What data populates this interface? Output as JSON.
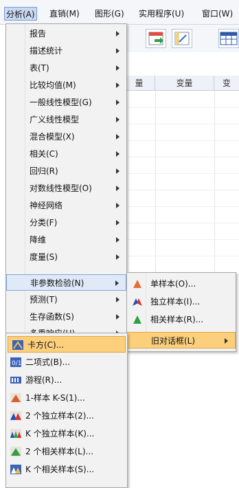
{
  "menubar": {
    "items": [
      {
        "label": "分析(A)",
        "active": true
      },
      {
        "label": "直销(M)"
      },
      {
        "label": "图形(G)"
      },
      {
        "label": "实用程序(U)"
      },
      {
        "label": "窗口(W)"
      }
    ]
  },
  "grid": {
    "col1": "量",
    "col2": "变量",
    "col3": "变"
  },
  "analyze_menu": {
    "items": [
      {
        "label": "报告"
      },
      {
        "label": "描述统计"
      },
      {
        "label": "表(T)"
      },
      {
        "label": "比较均值(M)"
      },
      {
        "label": "一般线性模型(G)"
      },
      {
        "label": "广义线性模型"
      },
      {
        "label": "混合模型(X)"
      },
      {
        "label": "相关(C)"
      },
      {
        "label": "回归(R)"
      },
      {
        "label": "对数线性模型(O)"
      },
      {
        "label": "神经网络"
      },
      {
        "label": "分类(F)"
      },
      {
        "label": "降维"
      },
      {
        "label": "度量(S)"
      },
      {
        "label": "非参数检验(N)"
      },
      {
        "label": "预测(T)"
      },
      {
        "label": "生存函数(S)"
      },
      {
        "label": "多重响应(U)"
      }
    ]
  },
  "nonparam_menu": {
    "items": [
      {
        "label": "单样本(O)...",
        "icon": "one-sample-icon"
      },
      {
        "label": "独立样本(I)...",
        "icon": "independent-samples-icon"
      },
      {
        "label": "相关样本(R)...",
        "icon": "related-samples-icon"
      },
      {
        "label": "旧对话框(L)",
        "icon": ""
      }
    ]
  },
  "legacy_menu": {
    "items": [
      {
        "label": "卡方(C)...",
        "icon": "chi-square-icon"
      },
      {
        "label": "二项式(B)...",
        "icon": "binomial-icon"
      },
      {
        "label": "游程(R)...",
        "icon": "runs-icon"
      },
      {
        "label": "1-样本 K-S(1)...",
        "icon": "ks-one-sample-icon"
      },
      {
        "label": "2 个独立样本(2)...",
        "icon": "two-independent-samples-icon"
      },
      {
        "label": "K 个独立样本(K)...",
        "icon": "k-independent-samples-icon"
      },
      {
        "label": "2 个相关样本(L)...",
        "icon": "two-related-samples-icon"
      },
      {
        "label": "K 个相关样本(S)...",
        "icon": "k-related-samples-icon"
      }
    ]
  },
  "colors": {
    "highlight": "#fbcf7c",
    "hover": "#dfe9f7",
    "menubar_active": "#c9d9f1"
  }
}
